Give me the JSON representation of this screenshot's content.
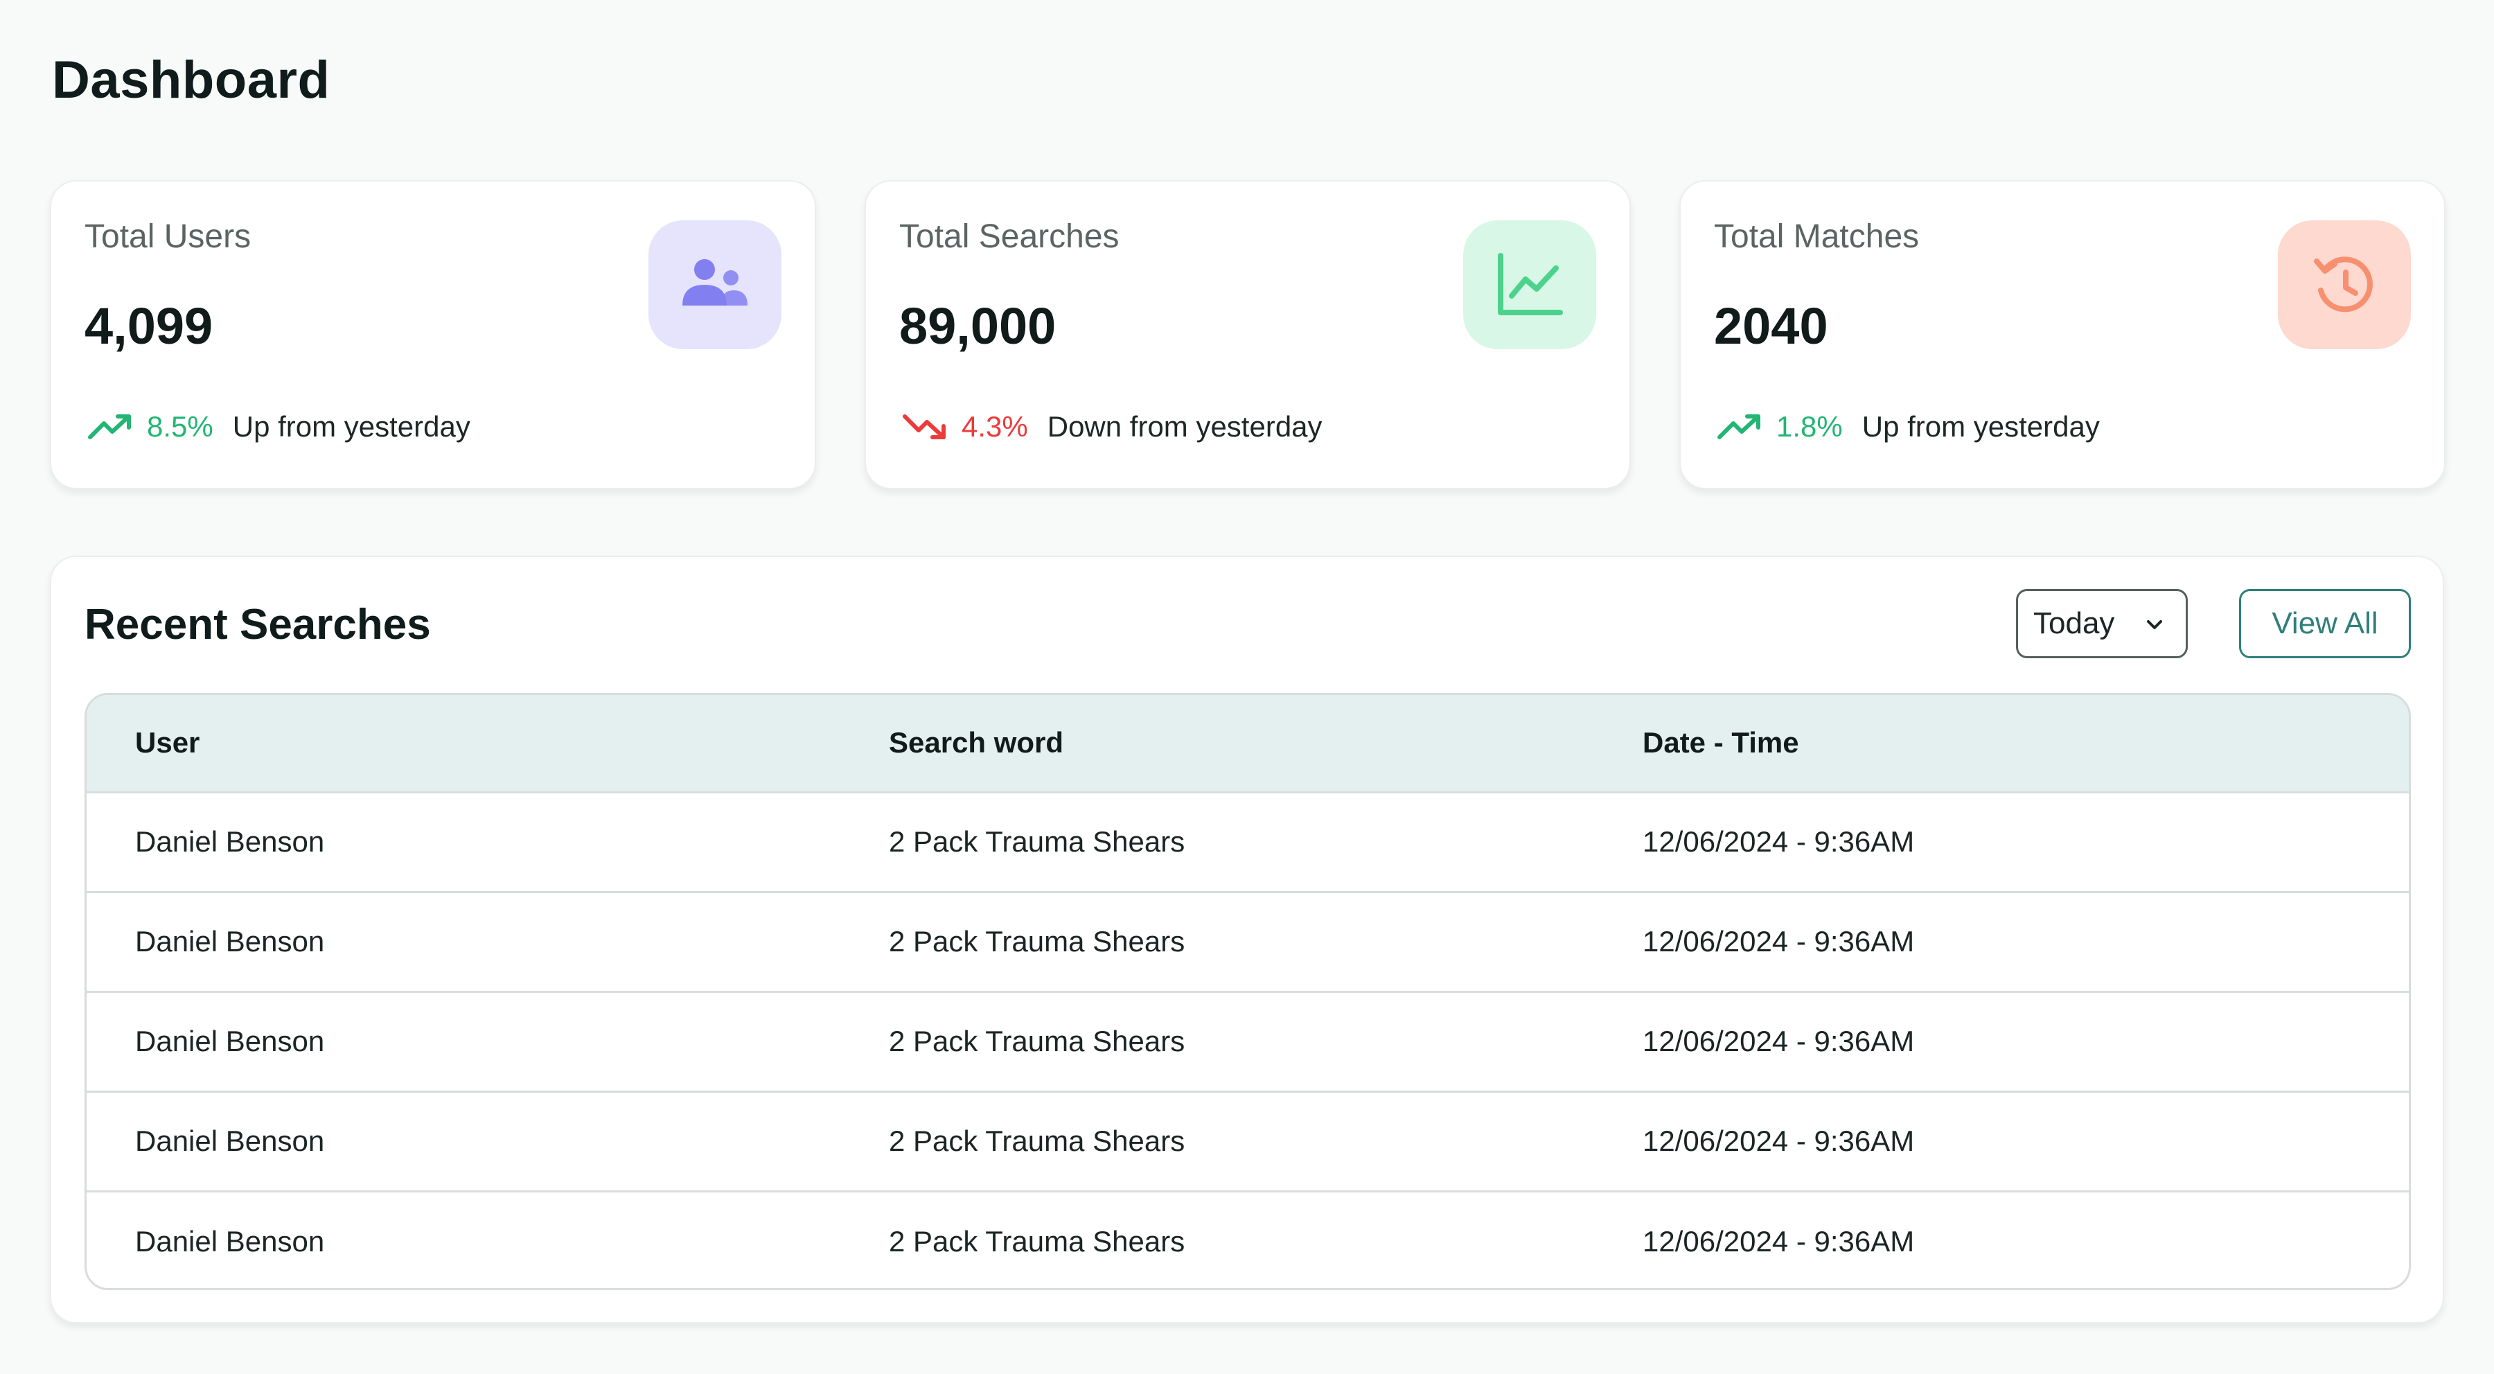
{
  "page": {
    "title": "Dashboard"
  },
  "stats": [
    {
      "label": "Total Users",
      "value": "4,099",
      "trend": {
        "direction": "up",
        "percent": "8.5%",
        "text": "Up from yesterday"
      },
      "icon": "users-icon",
      "icon_bg": "#e5e4fc",
      "icon_color": "#8280f0"
    },
    {
      "label": "Total Searches",
      "value": "89,000",
      "trend": {
        "direction": "down",
        "percent": "4.3%",
        "text": "Down from yesterday"
      },
      "icon": "line-chart-icon",
      "icon_bg": "#d9f7e7",
      "icon_color": "#4cd28c"
    },
    {
      "label": "Total Matches",
      "value": "2040",
      "trend": {
        "direction": "up",
        "percent": "1.8%",
        "text": "Up from yesterday"
      },
      "icon": "history-clock-icon",
      "icon_bg": "#fed9cf",
      "icon_color": "#f6906f"
    }
  ],
  "colors": {
    "up": "#22b573",
    "down": "#ec3b3b",
    "accent": "#2f7f7b"
  },
  "recent": {
    "title": "Recent Searches",
    "filter": {
      "selected": "Today"
    },
    "view_all": "View All",
    "columns": [
      "User",
      "Search word",
      "Date - Time"
    ],
    "rows": [
      [
        "Daniel Benson",
        "2 Pack Trauma Shears",
        "12/06/2024 - 9:36AM"
      ],
      [
        "Daniel Benson",
        "2 Pack Trauma Shears",
        "12/06/2024 - 9:36AM"
      ],
      [
        "Daniel Benson",
        "2 Pack Trauma Shears",
        "12/06/2024 - 9:36AM"
      ],
      [
        "Daniel Benson",
        "2 Pack Trauma Shears",
        "12/06/2024 - 9:36AM"
      ],
      [
        "Daniel Benson",
        "2 Pack Trauma Shears",
        "12/06/2024 - 9:36AM"
      ]
    ]
  }
}
